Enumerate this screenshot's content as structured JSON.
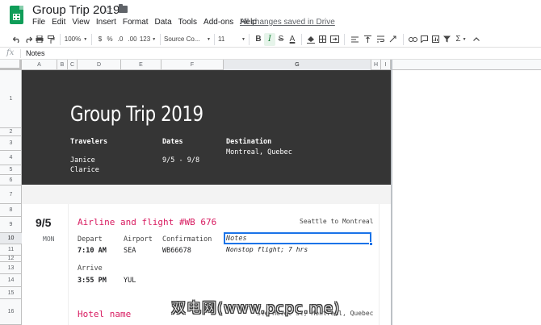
{
  "app": {
    "title": "Group Trip 2019",
    "menu": [
      "File",
      "Edit",
      "View",
      "Insert",
      "Format",
      "Data",
      "Tools",
      "Add-ons",
      "Help"
    ],
    "save_status": "All changes saved in Drive",
    "brand_color": "#0f9d58"
  },
  "toolbar": {
    "zoom": "100%",
    "currency": "$",
    "percent": "%",
    "decimal_less": ".0",
    "decimal_more": ".00",
    "number_format": "123",
    "font": "Source Co...",
    "font_size": "11",
    "bold": "B",
    "italic": "I",
    "text_color": "A",
    "sigma": "Σ"
  },
  "formula_bar": {
    "fx": "fx",
    "value": "Notes"
  },
  "grid": {
    "columns": [
      "A",
      "B",
      "C",
      "D",
      "E",
      "F",
      "G",
      "H",
      "I"
    ],
    "selected_column": "G",
    "rows": [
      "1",
      "2",
      "3",
      "4",
      "5",
      "6",
      "7",
      "8",
      "9",
      "10",
      "11",
      "12",
      "13",
      "14",
      "15",
      "16"
    ],
    "selected_row": "10"
  },
  "sheet": {
    "title": "Group Trip 2019",
    "travelers_label": "Travelers",
    "travelers": [
      "Janice",
      "Clarice"
    ],
    "dates_label": "Dates",
    "dates_value": "9/5 - 9/8",
    "destination_label": "Destination",
    "destination_value": "Montreal, Quebec",
    "header_bg": "#353535",
    "accent_color": "#d81b60"
  },
  "day": {
    "date": "9/5",
    "weekday": "MON",
    "flight": {
      "title": "Airline and flight #WB 676",
      "route": "Seattle to Montreal",
      "depart_label": "Depart",
      "depart_time": "7:10 AM",
      "airport_label": "Airport",
      "depart_airport": "SEA",
      "confirmation_label": "Confirmation",
      "confirmation": "WB66678",
      "notes_label": "Notes",
      "notes": "Nonstop flight; 7 hrs",
      "arrive_label": "Arrive",
      "arrive_time": "3:55 PM",
      "arrive_airport": "YUL"
    },
    "hotel": {
      "title": "Hotel name",
      "address": "Ste Hotel St, Montreal, Quebec"
    }
  },
  "watermark": "双电网(www.pcpc.me)"
}
